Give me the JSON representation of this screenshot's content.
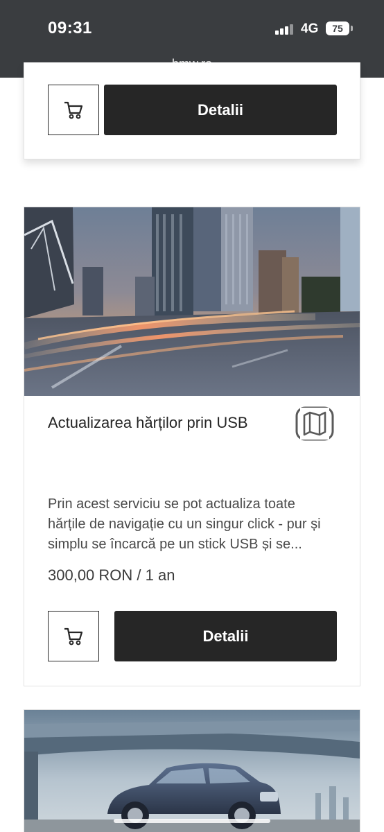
{
  "status_bar": {
    "time": "09:31",
    "network": "4G",
    "battery": "75",
    "url": "bmw.ro"
  },
  "cards": [
    {
      "details_label": "Detalii",
      "cart_icon": "cart-icon"
    },
    {
      "title": "Actualizarea hărților prin USB",
      "icon": "map-icon",
      "description": "Prin acest serviciu se pot actualiza toate hărțile de navigație cu un singur click - pur și simplu se încarcă pe un stick USB și se...",
      "price": "300,00 RON / 1 an",
      "details_label": "Detalii",
      "cart_icon": "cart-icon"
    },
    {}
  ],
  "colors": {
    "status_bar_bg": "#3a3d40",
    "button_dark": "#262626"
  }
}
